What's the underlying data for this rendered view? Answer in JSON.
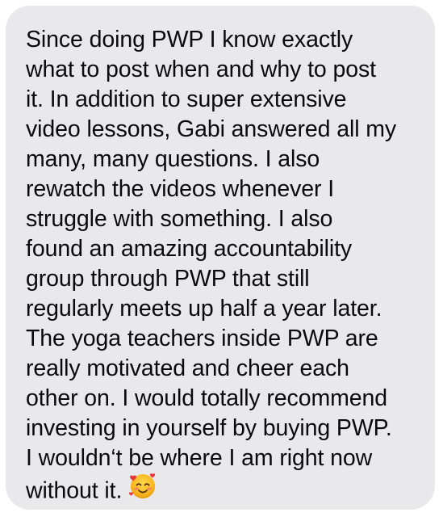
{
  "message": {
    "lines": [
      "Since doing PWP I know exactly",
      "what to post when and why to post",
      "it. In addition to super extensive",
      "video lessons, Gabi answered all my",
      "many, many questions. I also",
      "rewatch the videos whenever I",
      "struggle with something. I also",
      "found an amazing accountability",
      "group through PWP that still",
      "regularly meets up half a year later.",
      "The yoga teachers inside PWP are",
      "really motivated and cheer each",
      "other on. I would totally recommend",
      "investing in yourself by buying PWP.",
      "I wouldn‘t be where I am right now",
      "without it."
    ],
    "emoji": "smiling-face-with-hearts-icon"
  },
  "colors": {
    "bubble_background": "#e9e9eb",
    "text": "#0a0a0a",
    "emoji_face": "#f9b81f",
    "emoji_hearts": "#e8343b"
  }
}
